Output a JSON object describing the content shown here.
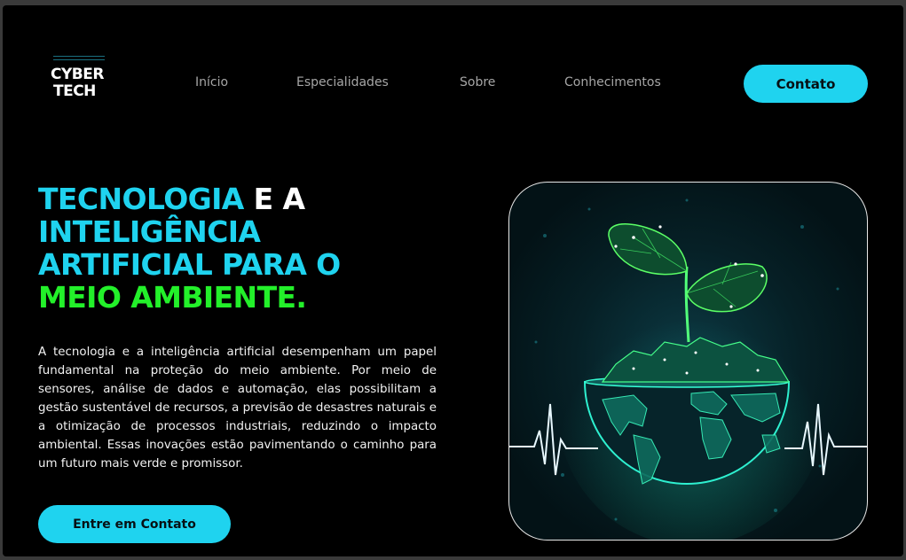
{
  "header": {
    "logo": {
      "line1": "CYBER",
      "line2": "TECH"
    },
    "nav": [
      "Início",
      "Especialidades",
      "Sobre",
      "Conhecimentos"
    ],
    "contact_button": "Contato"
  },
  "hero": {
    "title": {
      "w1": "TECNOLOGIA",
      "w2": " E A",
      "w3": "INTELIGÊNCIA",
      "w4": "ARTIFICIAL PARA O",
      "w5": "MEIO AMBIENTE."
    },
    "description": "A tecnologia e a inteligência artificial desempenham um papel fundamental na proteção do meio ambiente. Por meio de sensores, análise de dados e automação, elas possibilitam a gestão sustentável de recursos, a previsão de desastres naturais e a otimização de processos industriais, reduzindo o impacto ambiental. Essas inovações estão pavimentando o caminho para um futuro mais verde e promissor.",
    "cta_button": "Entre em Contato"
  },
  "colors": {
    "accent": "#1fd3ef",
    "highlight": "#23f02a",
    "background": "#000000"
  },
  "icons": {
    "illustration": "plant-globe-heartbeat-illustration"
  }
}
